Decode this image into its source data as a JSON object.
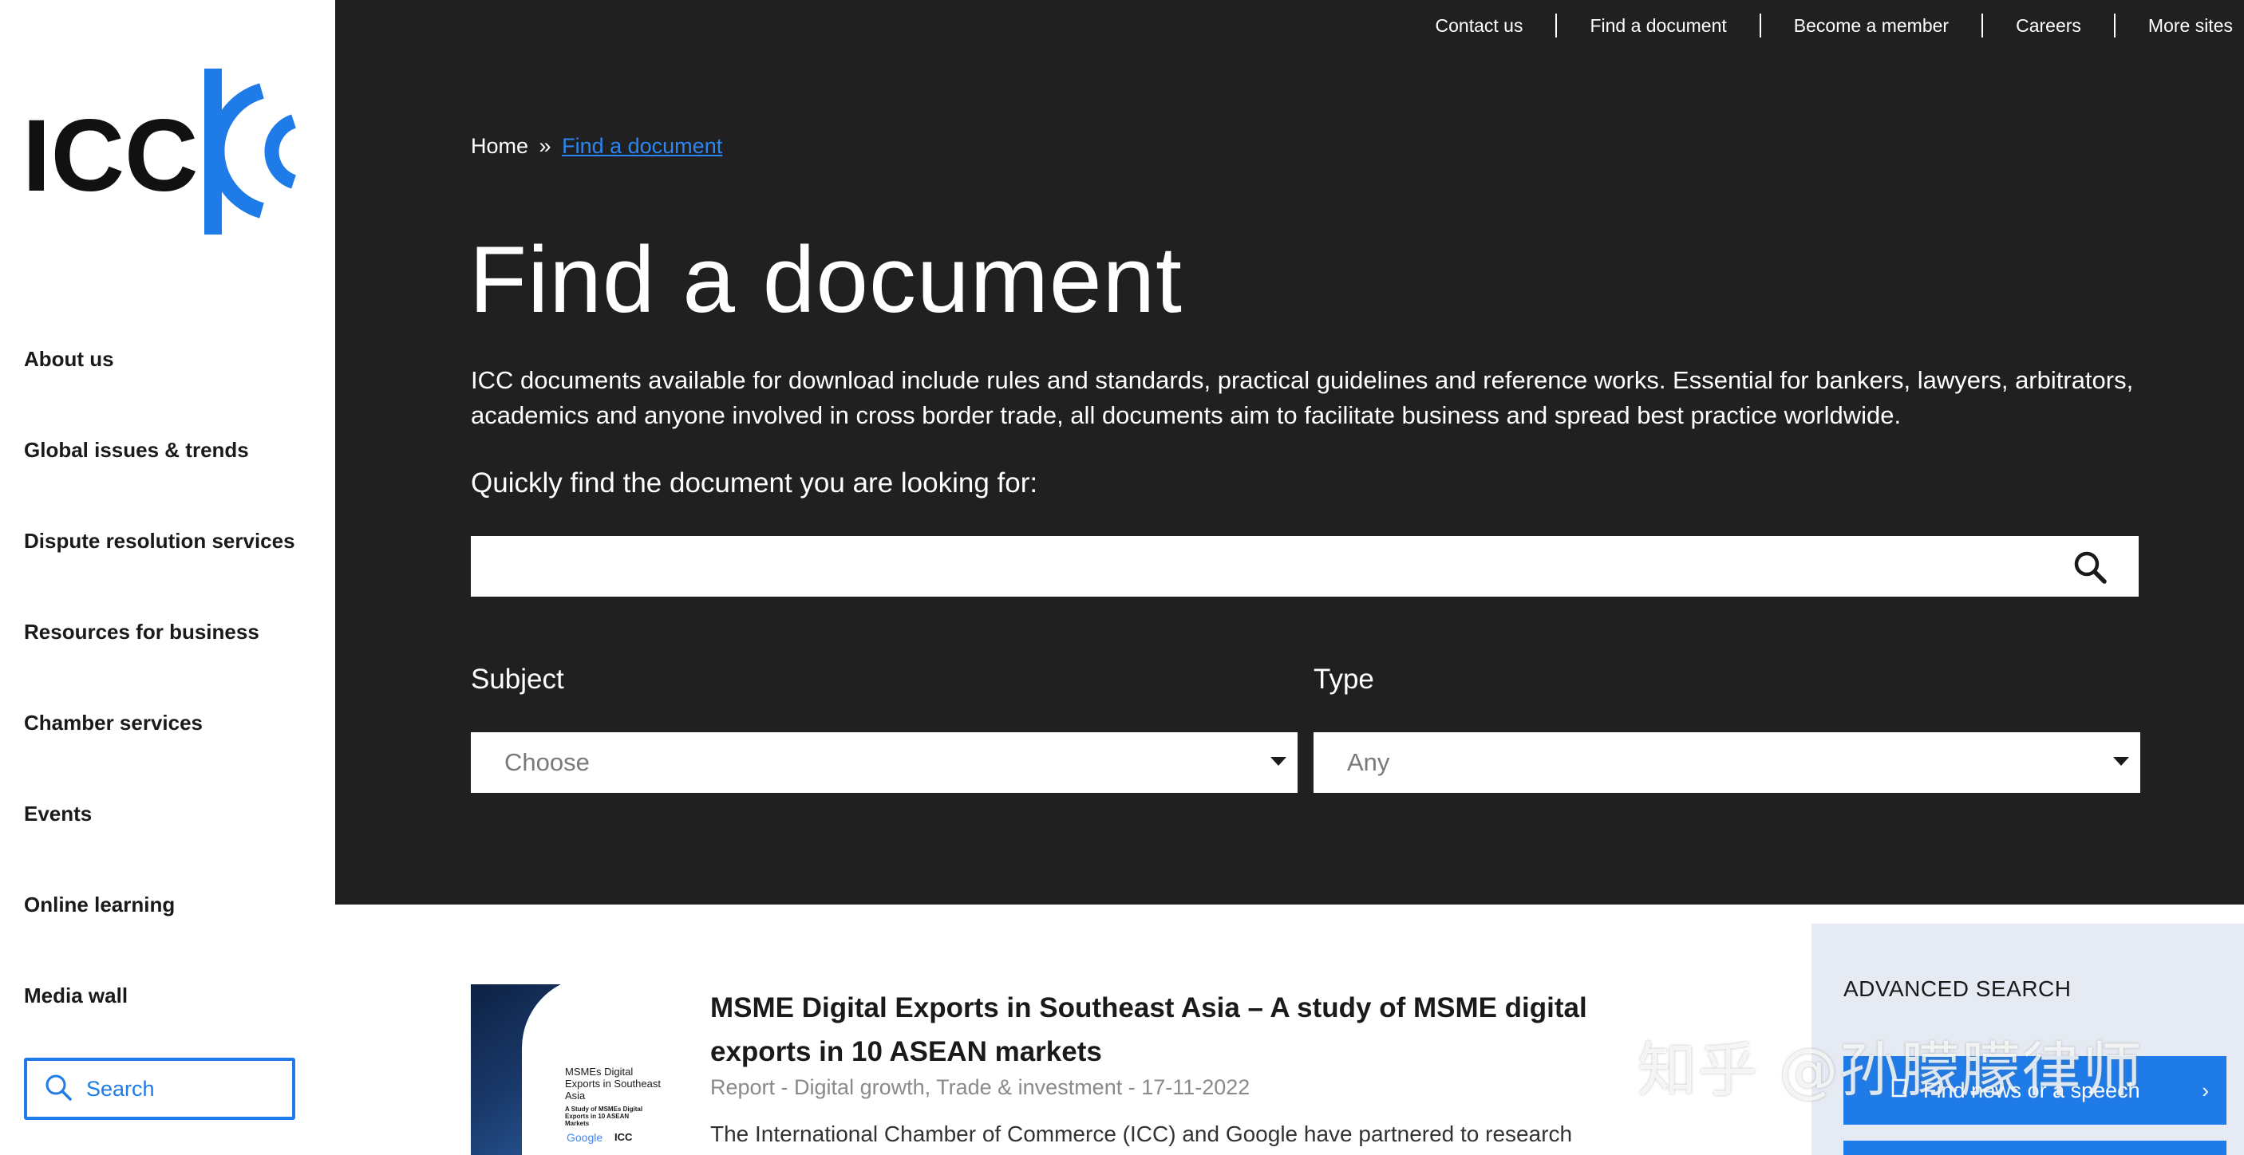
{
  "brand": {
    "logo_text": "ICC",
    "accent": "#1e7be8",
    "dark_bg": "#202021"
  },
  "sidebar": {
    "items": [
      {
        "label": "About us"
      },
      {
        "label": "Global issues & trends"
      },
      {
        "label": "Dispute resolution services"
      },
      {
        "label": "Resources for business"
      },
      {
        "label": "Chamber services"
      },
      {
        "label": "Events"
      },
      {
        "label": "Online learning"
      },
      {
        "label": "Media wall"
      }
    ],
    "search_label": "Search",
    "search_icon": "search-icon"
  },
  "topnav": {
    "items": [
      "Contact us",
      "Find a document",
      "Become a member",
      "Careers",
      "More sites"
    ]
  },
  "breadcrumb": {
    "home": "Home",
    "separator": "»",
    "current": "Find a document"
  },
  "hero": {
    "title": "Find a document",
    "intro": "ICC documents available for download include rules and standards, practical guidelines and reference works. Essential for bankers, lawyers, arbitrators, academics and anyone involved in cross border trade, all documents aim to facilitate business and spread best practice worldwide.",
    "prompt": "Quickly find the document you are looking for:",
    "search_value": "",
    "search_icon": "search-icon"
  },
  "filters": {
    "subject": {
      "label": "Subject",
      "selected": "Choose"
    },
    "type": {
      "label": "Type",
      "selected": "Any"
    }
  },
  "results": [
    {
      "title": "MSME Digital Exports in Southeast Asia – A study of MSME digital exports in 10 ASEAN markets",
      "meta": "Report - Digital growth, Trade & investment - 17-11-2022",
      "excerpt": "The International Chamber of Commerce (ICC) and Google have partnered to research",
      "thumb": {
        "heading": "MSMEs Digital Exports in Southeast Asia",
        "subheading": "A Study of MSMEs Digital Exports in 10 ASEAN Markets",
        "google": "Google",
        "icc": "ICC"
      }
    }
  ],
  "advanced": {
    "title": "ADVANCED SEARCH",
    "button_label": "Find news or a speech"
  },
  "watermark": "知乎 @孙朦朦律师"
}
